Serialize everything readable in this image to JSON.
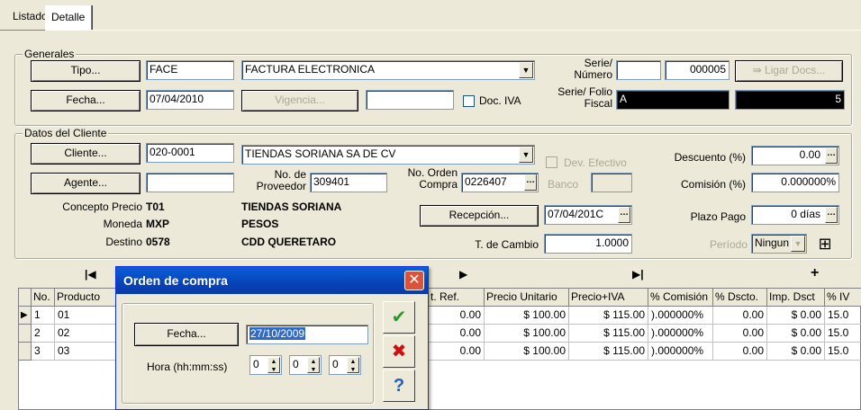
{
  "tabs": [
    {
      "label": "Listado"
    },
    {
      "label": "Detalle"
    }
  ],
  "generales": {
    "title": "Generales",
    "tipo_button": "Tipo...",
    "tipo_code": "FACE",
    "tipo_desc": "FACTURA ELECTRONICA",
    "fecha_button": "Fecha...",
    "fecha_value": "07/04/2010",
    "vigencia_button": "Vigencia...",
    "vigencia_value": "",
    "doc_iva_label": "Doc. IVA",
    "serie_numero_label": "Serie/\nNúmero",
    "serie_value": "",
    "numero_value": "000005",
    "ligar_docs_button": "Ligar Docs...",
    "serie_folio_label": "Serie/ Folio\nFiscal",
    "serie_fiscal_value": "A",
    "folio_fiscal_value": "5"
  },
  "cliente": {
    "title": "Datos del Cliente",
    "cliente_button": "Cliente...",
    "cliente_code": "020-0001",
    "cliente_name": "TIENDAS SORIANA SA DE CV",
    "dev_efectivo_label": "Dev. Efectivo",
    "banco_label": "Banco",
    "banco_value": "",
    "agente_button": "Agente...",
    "agente_value": "",
    "no_proveedor_label": "No. de\nProveedor",
    "no_proveedor_value": "309401",
    "no_orden_label": "No. Orden\nCompra",
    "no_orden_value": "0226407",
    "concepto_precio_label": "Concepto Precio",
    "concepto_precio_value": "T01",
    "concepto_precio_desc": "TIENDAS SORIANA",
    "moneda_label": "Moneda",
    "moneda_value": "MXP",
    "moneda_desc": "PESOS",
    "destino_label": "Destino",
    "destino_value": "0578",
    "destino_desc": "CDD QUERETARO",
    "recepcion_button": "Recepción...",
    "recepcion_value": "07/04/201C",
    "tipo_cambio_label": "T. de Cambio",
    "tipo_cambio_value": "1.0000",
    "descuento_label": "Descuento (%)",
    "descuento_value": "0.00",
    "comision_label": "Comisión (%)",
    "comision_value": "0.000000%",
    "plazo_label": "Plazo Pago",
    "plazo_value": "0 días",
    "periodo_label": "Período",
    "periodo_value": "Ningun"
  },
  "grid": {
    "nav": [
      "|◀",
      "▶",
      "▶|",
      "+"
    ],
    "headers": [
      "No.",
      "Producto",
      "t. Ref.",
      "Precio Unitario",
      "Precio+IVA",
      "% Comisión",
      "% Dscto.",
      "Imp. Dsct",
      "% IV"
    ],
    "rows": [
      {
        "no": "1",
        "producto": "01",
        "ref": "0.00",
        "precio": "$ 100.00",
        "precio_iva": "$ 115.00",
        "comision": ").000000%",
        "dscto": "0.00",
        "imp": "$ 0.00",
        "iva": "15.0"
      },
      {
        "no": "2",
        "producto": "02",
        "ref": "0.00",
        "precio": "$ 100.00",
        "precio_iva": "$ 115.00",
        "comision": ").000000%",
        "dscto": "0.00",
        "imp": "$ 0.00",
        "iva": "15.0"
      },
      {
        "no": "3",
        "producto": "03",
        "ref": "0.00",
        "precio": "$ 100.00",
        "precio_iva": "$ 115.00",
        "comision": ").000000%",
        "dscto": "0.00",
        "imp": "$ 0.00",
        "iva": "15.0"
      }
    ]
  },
  "dialog": {
    "title": "Orden de compra",
    "close": "✕",
    "fecha_button": "Fecha...",
    "fecha_value": "27/10/2009",
    "hora_label": "Hora (hh:mm:ss)",
    "hh": "0",
    "mm": "0",
    "ss": "0",
    "ok_glyph": "✔",
    "cancel_glyph": "✖",
    "help_glyph": "?"
  },
  "colors": {
    "accent": "#0842b8",
    "panel": "#ece9d8",
    "ok": "#2a9a2a",
    "cancel": "#cc1111",
    "help": "#1f5fbf"
  }
}
